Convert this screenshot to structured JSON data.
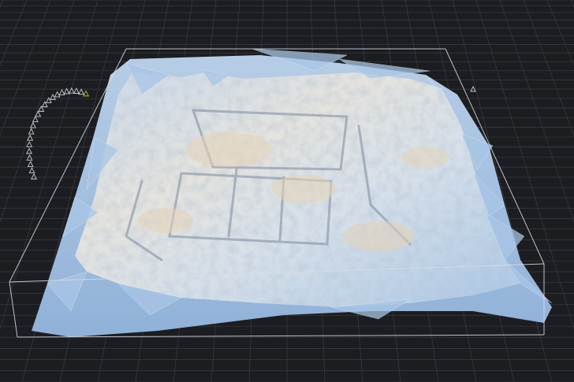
{
  "viewer": {
    "background_color": "#1c1d20",
    "grid_color": "#3a3d44",
    "bounding_box_color": "#d9dde3",
    "mesh_base_color": "#a9c6e6",
    "mesh_highlight_color": "#dfe7ee",
    "mesh_warm_color": "#e2d2bd",
    "mesh_shadow_color": "#6f8196",
    "camera_marker_color": "#c9ccd1",
    "active_camera_color": "#9ccc3a"
  },
  "scene": {
    "model": "terrain-mesh",
    "camera_path_icon": "camera-frustum-icon",
    "camera_count": 22
  }
}
